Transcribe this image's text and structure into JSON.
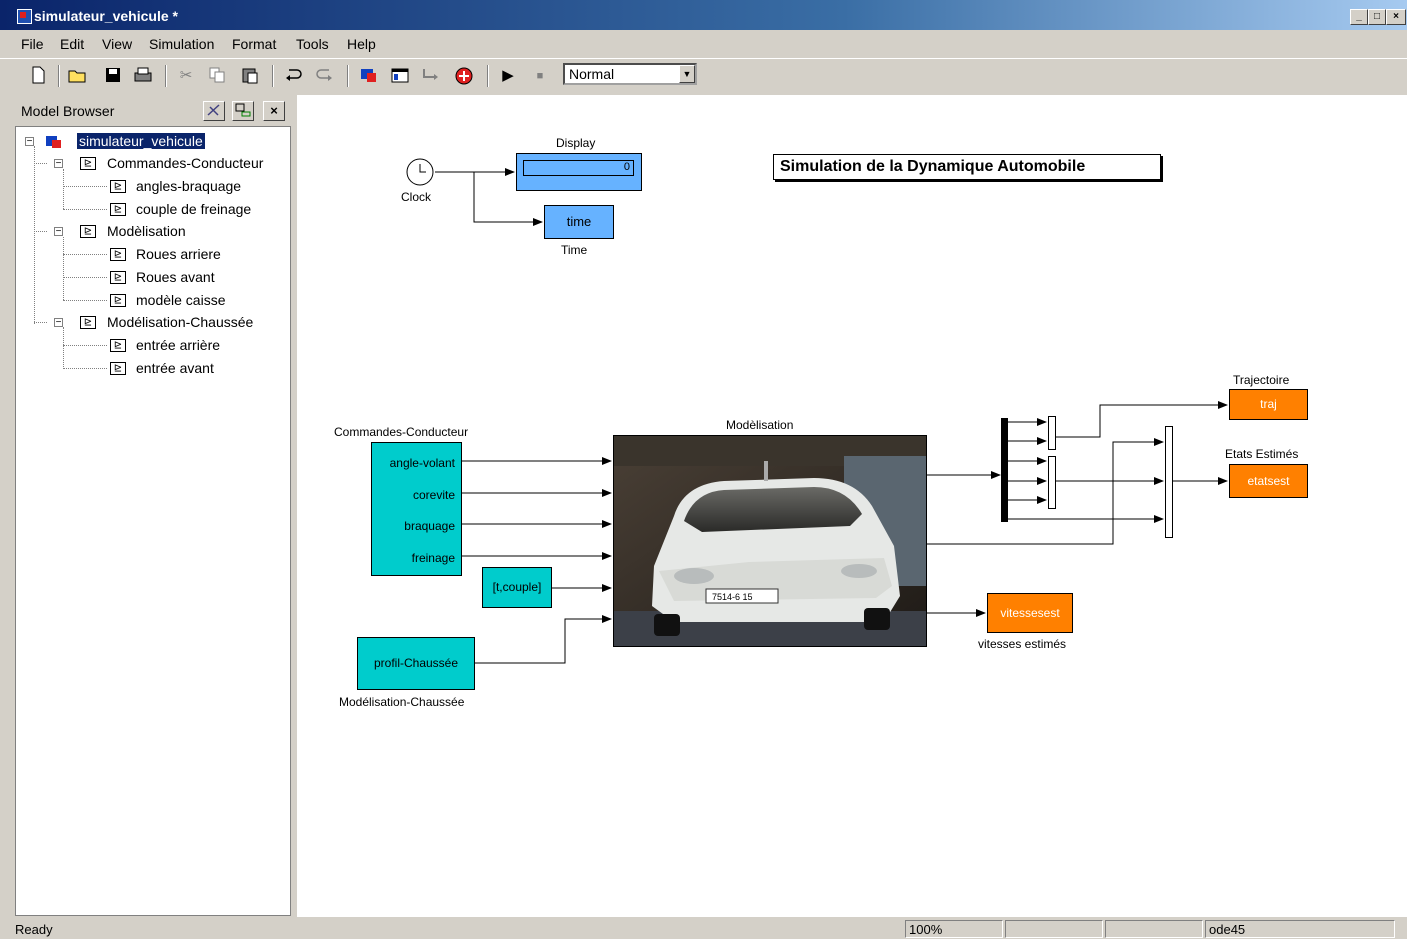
{
  "window": {
    "title": "simulateur_vehicule *",
    "minimize": "_",
    "maximize": "□",
    "close": "×"
  },
  "menu": [
    "File",
    "Edit",
    "View",
    "Simulation",
    "Format",
    "Tools",
    "Help"
  ],
  "toolbar": {
    "mode_value": "Normal"
  },
  "browser": {
    "title": "Model Browser",
    "close": "×",
    "root": "simulateur_vehicule",
    "items": [
      {
        "label": "Commandes-Conducteur",
        "children": [
          "angles-braquage",
          "couple de  freinage"
        ]
      },
      {
        "label": "Modèlisation",
        "children": [
          "Roues arriere",
          "Roues avant",
          "modèle caisse"
        ]
      },
      {
        "label": "Modélisation-Chaussée",
        "children": [
          "entrée arrière",
          "entrée avant"
        ]
      }
    ]
  },
  "diagram": {
    "title": "Simulation de la Dynamique Automobile",
    "clock_label": "Clock",
    "display_title": "Display",
    "display_value": "0",
    "time_block": "time",
    "time_label": "Time",
    "cmd_title": "Commandes-Conducteur",
    "cmd_ports": [
      "angle-volant",
      "corevite",
      "braquage",
      "freinage"
    ],
    "couple_block": "[t,couple]",
    "profil_block": "profil-Chaussée",
    "profil_label": "Modélisation-Chaussée",
    "model_title": "Modèlisation",
    "plate_text": "7514-6 15",
    "traj_title": "Trajectoire",
    "traj_block": "traj",
    "etats_title": "Etats Estimés",
    "etats_block": "etatsest",
    "vit_block": "vitessesest",
    "vit_label": "vitesses estimés"
  },
  "colors": {
    "cyan_block": "#00cccc",
    "blue_block": "#66b2ff",
    "orange_block": "#ff8000",
    "title_bar": "#0a246a"
  },
  "status": {
    "state": "Ready",
    "zoom": "100%",
    "solver": "ode45"
  }
}
